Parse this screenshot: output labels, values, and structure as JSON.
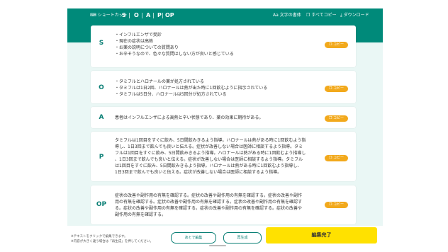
{
  "toolbar": {
    "shortcut": "ショートカット",
    "letters": [
      "S",
      "O",
      "A",
      "P",
      "OP"
    ],
    "font_size": "文字の書体",
    "copy_all": "すべてコピー",
    "download": "ダウンロード"
  },
  "cards": [
    {
      "letter": "S",
      "lines": [
        "・インフルエンザで受診",
        "・現在の症状は高熱",
        "・お薬の説明についての質問あり",
        "・お辛そうなので、色々な質問はしない方が良いと感じている"
      ],
      "copy": "コピー"
    },
    {
      "letter": "O",
      "lines": [
        "・タミフルとハロナールの薬が処方されている",
        "・タミフルは1日2回、ハロナールは熱が出た時に1回飲むように指示されている",
        "・タミフルは5日分、ハロナールは5回分が処方されている"
      ],
      "copy": "コピー"
    },
    {
      "letter": "A",
      "lines": [
        "患者はインフルエンザによる高熱と辛い状態であり、薬の効果に期待がある。"
      ],
      "copy": "コピー"
    },
    {
      "letter": "P",
      "lines": [
        "タミフルは1回目をすぐに飲み、5日間飲みきるよう指導。ハロナールは熱がある時に1回飲むよう指",
        "導し、1日3回まで飲んでも良いと伝える。症状が改善しない場合は医師に相談するよう指導。タミ",
        "フルは1回目をすぐに飲み、5日間飲みきるよう指導。ハロナールは熱がある時に1回飲むよう指導し",
        "、1日3回まで飲んでも良いと伝える。症状が改善しない場合は医師に相談するよう指導。タミフル",
        "は1回目をすぐに飲み、5日間飲みきるよう指導。ハロナールは熱がある時に1回飲むよう指導し、",
        "1日3回まで飲んでも良いと伝える。症状が改善しない場合は医師に相談するよう指導。"
      ],
      "copy": "コピー"
    },
    {
      "letter": "OP",
      "lines": [
        "症状の改善や副作用の有無を確認する。症状の改善や副作用の有無を確認する。症状の改善や副作",
        "用の有無を確認する。症状の改善や副作用の有無を確認する。症状の改善や副作用の有無を確認す",
        "る。症状の改善や副作用の有無を確認する。症状の改善や副作用の有無を確認する。症状の改善や",
        "副作用の有無を確認する。"
      ],
      "copy": "コピー"
    }
  ],
  "footer": {
    "note1": "※テキストをクリックで編集できます。",
    "note2": "※内容が大きく違う場合は「再生成」を押してください。",
    "edit_later": "あとで編集",
    "regenerate": "再生成",
    "done": "編集完了"
  },
  "colors": {
    "brand_green": "#008a7a",
    "accent_orange": "#f2a91c",
    "primary_yellow": "#ffe100",
    "background_mint": "#eaf7f5"
  }
}
